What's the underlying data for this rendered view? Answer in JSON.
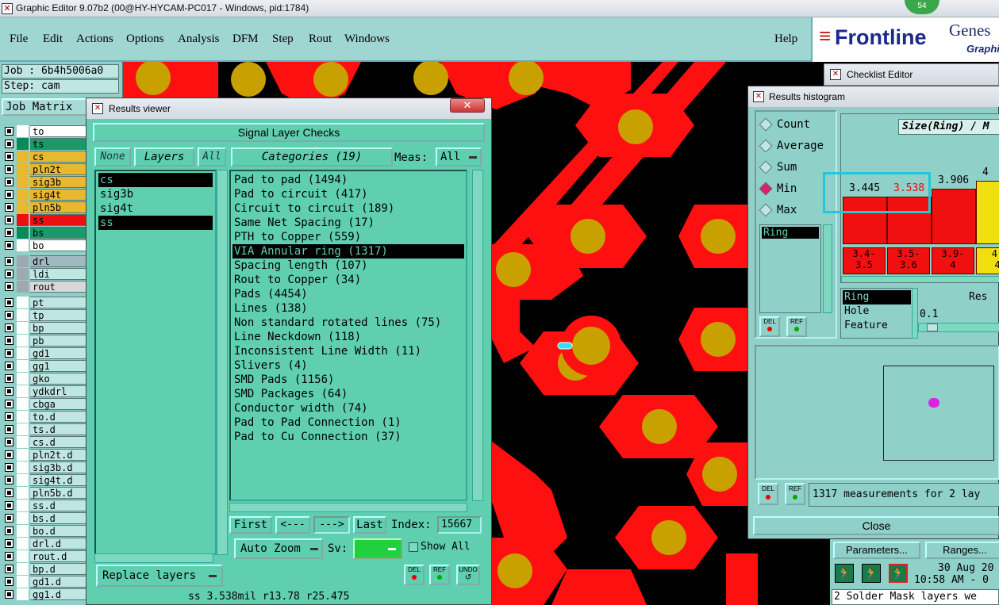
{
  "window": {
    "title": "Graphic Editor 9.07b2 (00@HY-HYCAM-PC017 - Windows, pid:1784)",
    "badge": "54"
  },
  "menu": {
    "items": [
      "File",
      "Edit",
      "Actions",
      "Options",
      "Analysis",
      "DFM",
      "Step",
      "Rout",
      "Windows"
    ],
    "help": "Help"
  },
  "logo": {
    "brand": "Frontline",
    "product": "Genes",
    "sub": "Graphi"
  },
  "left": {
    "job": "Job : 6b4h5006a0",
    "step": "Step: cam",
    "job_matrix": "Job Matrix",
    "layers": [
      {
        "name": "to",
        "color": "#ffffff",
        "text_bg": "#ffffff"
      },
      {
        "name": "ts",
        "color": "#0a8a5a",
        "text_bg": "#1a9a6a"
      },
      {
        "name": "cs",
        "color": "#e8b830",
        "text_bg": "#e8b830"
      },
      {
        "name": "pln2t",
        "color": "#e8b830",
        "text_bg": "#e8b830"
      },
      {
        "name": "sig3b",
        "color": "#e8b830",
        "text_bg": "#e8b830"
      },
      {
        "name": "sig4t",
        "color": "#e8b830",
        "text_bg": "#e8b830"
      },
      {
        "name": "pln5b",
        "color": "#e8b830",
        "text_bg": "#e8b830"
      },
      {
        "name": "ss",
        "color": "#ee1010",
        "text_bg": "#ee1010"
      },
      {
        "name": "bs",
        "color": "#0a8a5a",
        "text_bg": "#1a9a6a"
      },
      {
        "name": "bo",
        "color": "#ffffff",
        "text_bg": "#ffffff"
      }
    ],
    "drill_layers": [
      {
        "name": "drl",
        "color": "#a0a8b0",
        "text_bg": "#a0b8c0"
      },
      {
        "name": "ldi",
        "color": "#a0a8b0",
        "text_bg": "#bfe6e2"
      },
      {
        "name": "rout",
        "color": "#a0a8b0",
        "text_bg": "#d8d8d8"
      }
    ],
    "misc_layers": [
      "pt",
      "tp",
      "bp",
      "pb",
      "gd1",
      "gg1",
      "gko",
      "ydkdrl",
      "cbga",
      "to.d",
      "ts.d",
      "cs.d",
      "pln2t.d",
      "sig3b.d",
      "sig4t.d",
      "pln5b.d",
      "ss.d",
      "bs.d",
      "bo.d",
      "drl.d",
      "rout.d",
      "bp.d",
      "gd1.d",
      "gg1.d"
    ]
  },
  "results_viewer": {
    "title": "Results viewer",
    "close": "✕",
    "header": "Signal Layer Checks",
    "none_btn": "None",
    "layers_btn": "Layers",
    "all_btn": "All",
    "categories_btn": "Categories (19)",
    "meas_label": "Meas:",
    "meas_value": "All",
    "layer_list": [
      {
        "name": "cs",
        "selected": true
      },
      {
        "name": "sig3b",
        "selected": false
      },
      {
        "name": "sig4t",
        "selected": false
      },
      {
        "name": "ss",
        "selected": true
      }
    ],
    "categories": [
      "Pad to pad (1494)",
      "Pad to circuit (417)",
      "Circuit to circuit (189)",
      "Same Net Spacing (17)",
      "PTH to Copper (559)",
      "VIA Annular ring (1317)",
      "Spacing length (107)",
      "Rout to Copper (34)",
      "Pads (4454)",
      "Lines (138)",
      "Non standard rotated lines (75)",
      "Line Neckdown (118)",
      "Inconsistent Line Width (11)",
      "Slivers (4)",
      "SMD Pads (1156)",
      "SMD Packages (64)",
      "Conductor width (74)",
      "Pad to Pad Connection (1)",
      "Pad to Cu Connection (37)"
    ],
    "selected_category_index": 5,
    "nav": {
      "first": "First",
      "prev": "<---",
      "next": "--->",
      "last": "Last",
      "index_label": "Index:",
      "index_value": "15667"
    },
    "auto_zoom": "Auto Zoom",
    "sv_label": "Sv:",
    "show_all": "Show All",
    "replace_layers": "Replace layers",
    "del": "DEL",
    "ref": "REF",
    "undo": "UNDO",
    "status": "ss 3.538mil  r13.78  r25.475"
  },
  "checklist_editor": {
    "title": "Checklist Editor"
  },
  "histogram": {
    "title": "Results histogram",
    "modes": [
      "Count",
      "Average",
      "Sum",
      "Min",
      "Max"
    ],
    "selected_mode": "Min",
    "field": "Ring",
    "chart_title": "Size(Ring) / M",
    "bar_values": [
      "3.445",
      "3.538",
      "3.906",
      "4"
    ],
    "bar_ranges": [
      [
        "3.4-",
        "3.5"
      ],
      [
        "3.5-",
        "3.6"
      ],
      [
        "3.9-",
        "4"
      ],
      [
        "4-",
        "4"
      ]
    ],
    "attrs": [
      "Ring",
      "Hole",
      "Feature"
    ],
    "res_label": "Res",
    "res_value": "0.1",
    "summary": "1317 measurements for 2 lay",
    "close": "Close",
    "del": "DEL",
    "ref": "REF"
  },
  "bottom_right": {
    "parameters": "Parameters...",
    "ranges": "Ranges...",
    "date": "30 Aug 20",
    "time": "10:58 AM - 0",
    "message": "2 Solder Mask layers we"
  },
  "colors": {
    "board_bg": "#000000",
    "copper": "#ff1010",
    "drill": "#c8a000",
    "panel": "#5fcfb0",
    "accent": "#00c0d0"
  }
}
